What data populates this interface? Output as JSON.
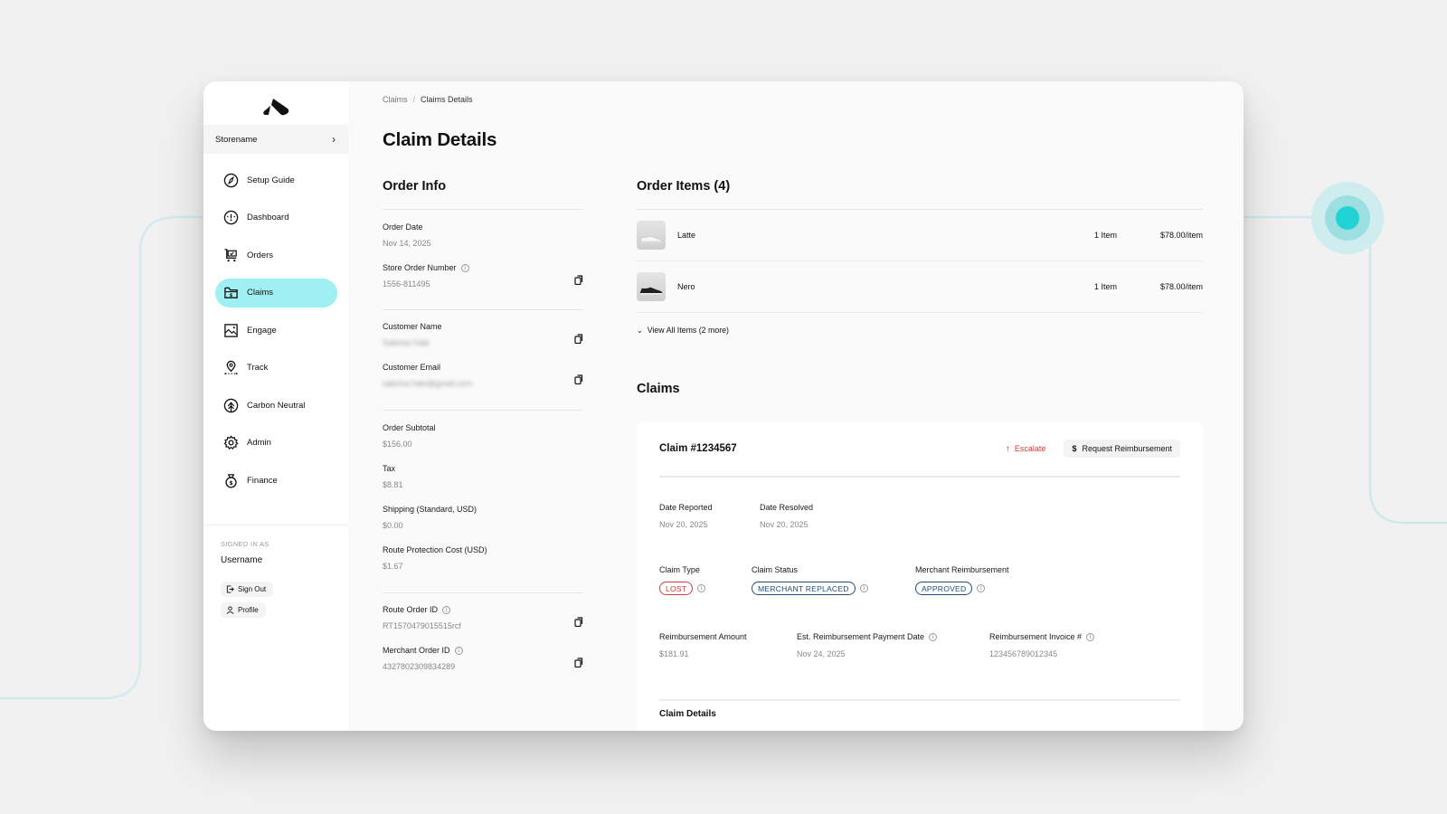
{
  "colors": {
    "accent": "#9ff0f3",
    "teal_dot": "#22d3d6",
    "danger": "#d23a3a",
    "info_badge": "#1f4e79"
  },
  "sidebar": {
    "logo": "route-logo",
    "store_name": "Storename",
    "items": [
      {
        "label": "Setup Guide",
        "icon": "compass-icon",
        "active": false
      },
      {
        "label": "Dashboard",
        "icon": "gauge-icon",
        "active": false
      },
      {
        "label": "Orders",
        "icon": "cart-icon",
        "active": false
      },
      {
        "label": "Claims",
        "icon": "claims-folder-icon",
        "active": true
      },
      {
        "label": "Engage",
        "icon": "image-icon",
        "active": false
      },
      {
        "label": "Track",
        "icon": "location-pin-icon",
        "active": false
      },
      {
        "label": "Carbon Neutral",
        "icon": "tree-icon",
        "active": false
      },
      {
        "label": "Admin",
        "icon": "gear-icon",
        "active": false
      },
      {
        "label": "Finance",
        "icon": "money-bag-icon",
        "active": false
      }
    ],
    "signed_in_label": "SIGNED IN AS",
    "username": "Username",
    "sign_out": "Sign Out",
    "profile": "Profile"
  },
  "breadcrumb": {
    "parent": "Claims",
    "separator": "/",
    "current": "Claims Details"
  },
  "page_title": "Claim Details",
  "order_info": {
    "title": "Order Info",
    "order_date_label": "Order Date",
    "order_date": "Nov 14, 2025",
    "store_order_label": "Store Order Number",
    "store_order": "1556-811495",
    "customer_name_label": "Customer Name",
    "customer_name": "Sabrina Hale",
    "customer_email_label": "Customer Email",
    "customer_email": "sabrina.hale@gmail.com",
    "subtotal_label": "Order Subtotal",
    "subtotal": "$156.00",
    "tax_label": "Tax",
    "tax": "$8.81",
    "shipping_label": "Shipping (Standard, USD)",
    "shipping": "$0.00",
    "protection_label": "Route Protection Cost (USD)",
    "protection": "$1.67",
    "route_order_label": "Route Order ID",
    "route_order": "RT1570479015515rcf",
    "merchant_order_label": "Merchant Order ID",
    "merchant_order": "4327802309834289"
  },
  "order_items": {
    "title": "Order Items (4)",
    "items": [
      {
        "name": "Latte",
        "qty": "1 Item",
        "price": "$78.00/item",
        "shoe": "white"
      },
      {
        "name": "Nero",
        "qty": "1 Item",
        "price": "$78.00/item",
        "shoe": "black"
      }
    ],
    "view_all": "View All Items (2 more)"
  },
  "claims": {
    "title": "Claims",
    "claim_title": "Claim #1234567",
    "escalate": "Escalate",
    "request_reimbursement": "Request Reimbursement",
    "date_reported_label": "Date Reported",
    "date_reported": "Nov 20, 2025",
    "date_resolved_label": "Date Resolved",
    "date_resolved": "Nov 20, 2025",
    "claim_type_label": "Claim Type",
    "claim_type": "LOST",
    "claim_status_label": "Claim Status",
    "claim_status": "MERCHANT REPLACED",
    "merchant_reimb_label": "Merchant Reimbursement",
    "merchant_reimb": "APPROVED",
    "reimb_amount_label": "Reimbursement Amount",
    "reimb_amount": "$181.91",
    "est_payment_label": "Est. Reimbursement Payment Date",
    "est_payment": "Nov 24, 2025",
    "invoice_label": "Reimbursement Invoice #",
    "invoice": "123456789012345",
    "details_title": "Claim Details"
  }
}
